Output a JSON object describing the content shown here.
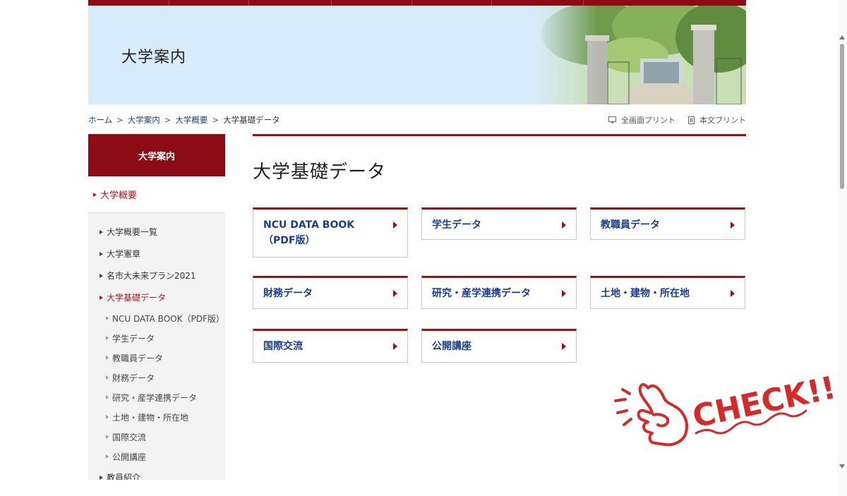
{
  "hero": {
    "title": "大学案内"
  },
  "breadcrumb": {
    "items": [
      "ホーム",
      "大学案内",
      "大学概要"
    ],
    "separator": ">",
    "current": "大学基礎データ"
  },
  "print_tools": {
    "full": "全画面プリント",
    "body": "本文プリント"
  },
  "sidebar": {
    "header": "大学案内",
    "parent": "大学概要",
    "items": [
      {
        "label": "大学概要一覧"
      },
      {
        "label": "大学憲章"
      },
      {
        "label": "名市大未来プラン2021"
      },
      {
        "label": "大学基礎データ"
      }
    ],
    "subitems": [
      "NCU DATA BOOK（PDF版）",
      "学生データ",
      "教職員データ",
      "財務データ",
      "研究・産学連携データ",
      "土地・建物・所在地",
      "国際交流",
      "公開講座"
    ],
    "cut_item": "教員紹介"
  },
  "main": {
    "title": "大学基礎データ",
    "cards": [
      "NCU DATA BOOK（PDF版）",
      "学生データ",
      "教職員データ",
      "財務データ",
      "研究・産学連携データ",
      "土地・建物・所在地",
      "国際交流",
      "公開講座"
    ]
  },
  "badge": {
    "text": "CHECK!!"
  },
  "colors": {
    "brand": "#8b0c14",
    "link": "#1a3d8f",
    "active": "#b5161f",
    "hero_bg": "#d8ebfa"
  }
}
